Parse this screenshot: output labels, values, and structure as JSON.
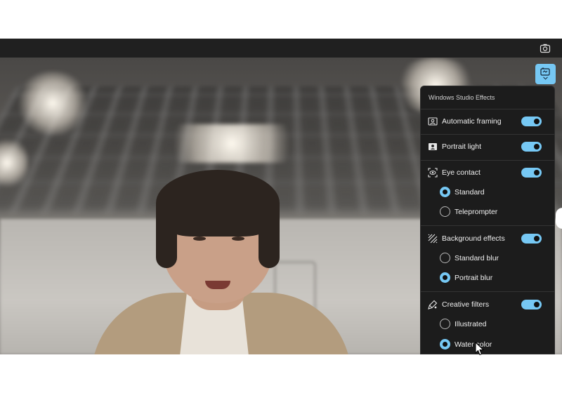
{
  "toolbar": {
    "camera_icon": "camera-settings-icon"
  },
  "effects_button": {
    "icon": "studio-effects-icon",
    "chevron": "chevron-down-icon",
    "accent": "#76c8f4"
  },
  "panel": {
    "title": "Windows Studio Effects",
    "sections": [
      {
        "label": "Automatic framing",
        "icon": "framing-icon",
        "enabled": true
      },
      {
        "label": "Portrait light",
        "icon": "portrait-light-icon",
        "enabled": true
      },
      {
        "label": "Eye contact",
        "icon": "eye-contact-icon",
        "enabled": true,
        "options": [
          {
            "label": "Standard",
            "selected": true
          },
          {
            "label": "Teleprompter",
            "selected": false
          }
        ]
      },
      {
        "label": "Background effects",
        "icon": "background-effects-icon",
        "enabled": true,
        "options": [
          {
            "label": "Standard blur",
            "selected": false
          },
          {
            "label": "Portrait blur",
            "selected": true
          }
        ]
      },
      {
        "label": "Creative filters",
        "icon": "creative-filters-icon",
        "enabled": true,
        "options": [
          {
            "label": "Illustrated",
            "selected": false
          },
          {
            "label": "Water color",
            "selected": true
          }
        ]
      }
    ]
  }
}
